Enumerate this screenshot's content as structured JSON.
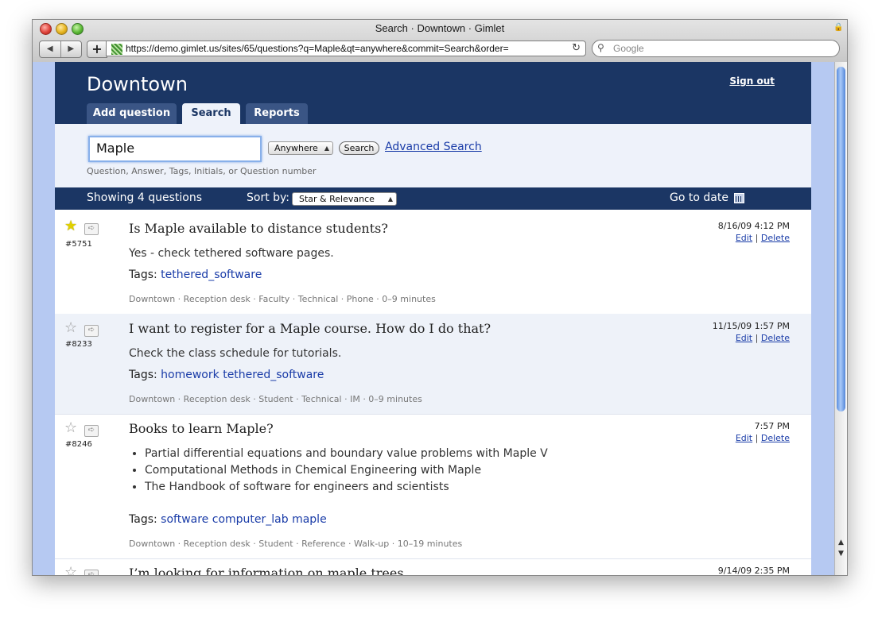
{
  "window": {
    "title": "Search · Downtown · Gimlet"
  },
  "toolbar": {
    "back": "◀",
    "forward": "▶",
    "add": "+",
    "url": "https://demo.gimlet.us/sites/65/questions?q=Maple&qt=anywhere&commit=Search&order=",
    "reload": "↻",
    "search_placeholder": "Google"
  },
  "header": {
    "site_title": "Downtown",
    "sign_out": "Sign out",
    "tabs": [
      {
        "label": "Add question",
        "active": false
      },
      {
        "label": "Search",
        "active": true
      },
      {
        "label": "Reports",
        "active": false
      }
    ]
  },
  "search": {
    "query": "Maple",
    "scope": "Anywhere",
    "button": "Search",
    "advanced": "Advanced Search",
    "hint": "Question, Answer, Tags, Initials, or Question number"
  },
  "results_bar": {
    "showing": "Showing 4 questions",
    "sort_label": "Sort by:",
    "sort_value": "Star & Relevance",
    "go_to_date": "Go to date"
  },
  "questions": [
    {
      "starred": true,
      "number": "#5751",
      "title": "Is Maple available to distance students?",
      "answer": "Yes - check tethered software pages.",
      "tags_label": "Tags:",
      "tags": [
        "tethered_software"
      ],
      "meta": "Downtown · Reception desk · Faculty · Technical · Phone · 0–9 minutes",
      "date": "8/16/09 4:12 PM",
      "edit": "Edit",
      "sep": "|",
      "delete": "Delete"
    },
    {
      "starred": false,
      "number": "#8233",
      "title": "I want to register for a Maple course. How do I do that?",
      "answer": "Check the class schedule for tutorials.",
      "tags_label": "Tags:",
      "tags": [
        "homework",
        "tethered_software"
      ],
      "meta": "Downtown · Reception desk · Student · Technical · IM · 0–9 minutes",
      "date": "11/15/09 1:57 PM",
      "edit": "Edit",
      "sep": "|",
      "delete": "Delete"
    },
    {
      "starred": false,
      "number": "#8246",
      "title": "Books to learn Maple?",
      "answer_items": [
        "Partial differential equations and boundary value problems with Maple V",
        "Computational Methods in Chemical Engineering with Maple",
        "The Handbook of software for engineers and scientists"
      ],
      "tags_label": "Tags:",
      "tags": [
        "software",
        "computer_lab",
        "maple"
      ],
      "meta": "Downtown · Reception desk · Student · Reference · Walk-up · 10–19 minutes",
      "date": "7:57 PM",
      "edit": "Edit",
      "sep": "|",
      "delete": "Delete"
    },
    {
      "starred": false,
      "title": "I’m looking for information on maple trees",
      "date": "9/14/09 2:35 PM"
    }
  ],
  "colors": {
    "header_bg": "#1b3664",
    "panel_bg": "#eef2fa",
    "link": "#1a3ca8",
    "star_on": "#e0d000",
    "page_side": "#b6c9f2"
  },
  "icons": [
    "star-icon",
    "forward-icon",
    "calendar-icon",
    "reload-icon",
    "search-icon",
    "lock-icon"
  ]
}
